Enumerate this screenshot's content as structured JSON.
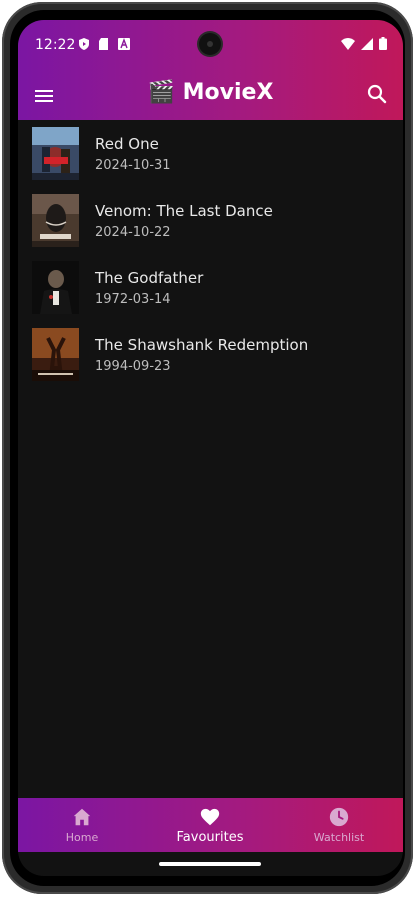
{
  "status": {
    "time": "12:22"
  },
  "appbar": {
    "title": "MovieX",
    "title_emoji": "🎬",
    "menu_icon": "menu-icon",
    "search_icon": "search-icon"
  },
  "movies": [
    {
      "title": "Red One",
      "date": "2024-10-31"
    },
    {
      "title": "Venom: The Last Dance",
      "date": "2024-10-22"
    },
    {
      "title": "The Godfather",
      "date": "1972-03-14"
    },
    {
      "title": "The Shawshank Redemption",
      "date": "1994-09-23"
    }
  ],
  "bottom_nav": {
    "items": [
      {
        "label": "Home",
        "icon": "home-icon",
        "active": false
      },
      {
        "label": "Favourites",
        "icon": "heart-icon",
        "active": true
      },
      {
        "label": "Watchlist",
        "icon": "clock-icon",
        "active": false
      }
    ]
  },
  "colors": {
    "gradient_start": "#7b16a3",
    "gradient_end": "#c0185a",
    "background": "#121212",
    "text_primary": "#e8e8e8",
    "text_secondary": "#bdbdbd"
  }
}
